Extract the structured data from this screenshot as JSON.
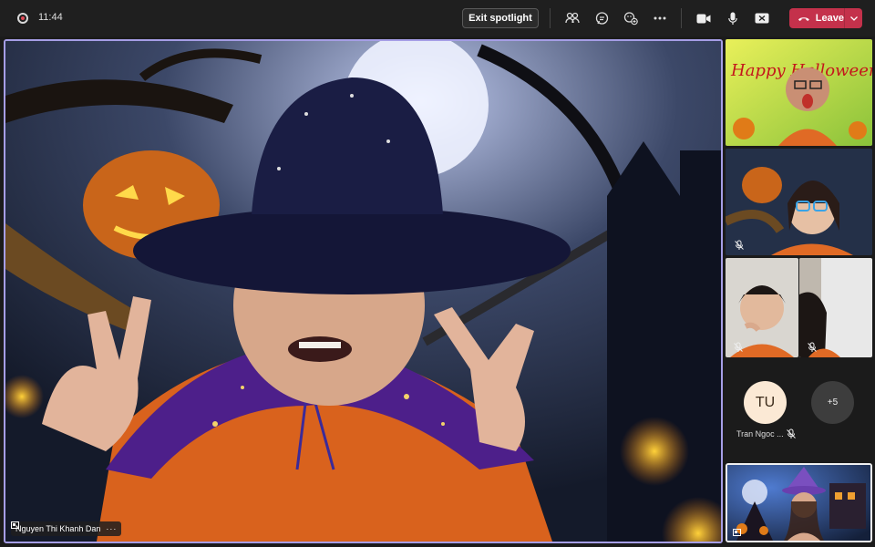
{
  "toolbar": {
    "timer": "11:44",
    "exit_spotlight_label": "Exit spotlight",
    "leave_label": "Leave"
  },
  "icons": {
    "record": "record-dot-icon",
    "people": "people-icon",
    "chat": "chat-icon",
    "reactions": "reactions-icon",
    "more": "more-icon",
    "camera": "camera-icon",
    "mic": "microphone-icon",
    "share": "share-screen-icon",
    "phone": "phone-icon"
  },
  "colors": {
    "leave": "#c4314b",
    "spotlight_border": "#a69ee6",
    "toolbar_bg": "#1f1f1f"
  },
  "spotlight": {
    "participant_name": "Nguyen Thi Khanh Dan",
    "more": "···"
  },
  "gallery": {
    "happy_text": "Happy Halloween",
    "tu_initials": "TU",
    "tu_name": "Tran Ngoc ...",
    "overflow_count": "+5"
  }
}
